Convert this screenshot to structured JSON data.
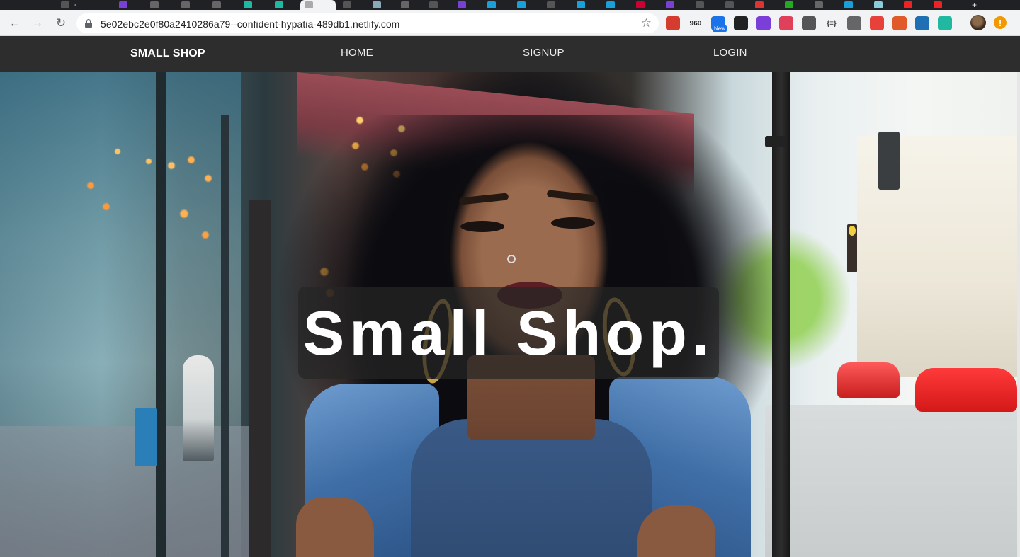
{
  "browser": {
    "url": "5e02ebc2e0f80a2410286a79--confident-hypatia-489db1.netlify.com",
    "extensions": [
      {
        "icon": "red-square-extension-icon",
        "label": "",
        "color": "#d33c2f"
      },
      {
        "icon": "960-extension-icon",
        "label": "960",
        "color": "#222222"
      },
      {
        "icon": "chrome-new-extension-icon",
        "label": "",
        "badge": "New",
        "color": "#1a73e8"
      },
      {
        "icon": "owl-extension-icon",
        "label": "",
        "color": "#222222"
      },
      {
        "icon": "color-cube-extension-icon",
        "label": "",
        "color": "#7b3fd9"
      },
      {
        "icon": "dots-extension-icon",
        "label": "",
        "color": "#e0405a"
      },
      {
        "icon": "eyedropper-extension-icon",
        "label": "",
        "color": "#555555"
      },
      {
        "icon": "json-extension-icon",
        "label": "{≡}",
        "color": "#333333"
      },
      {
        "icon": "gear-extension-icon",
        "label": "",
        "color": "#666666"
      },
      {
        "icon": "swirl-extension-icon",
        "label": "",
        "color": "#e8413b"
      },
      {
        "icon": "mascot-extension-icon",
        "label": "",
        "color": "#e05a2a"
      },
      {
        "icon": "react-extension-icon",
        "label": "",
        "color": "#1e6fb3"
      },
      {
        "icon": "target-extension-icon",
        "label": "",
        "color": "#20b8a0"
      }
    ],
    "update_label": "!"
  },
  "site": {
    "brand": "SMALL SHOP",
    "nav": [
      {
        "label": "HOME"
      },
      {
        "label": "SIGNUP"
      },
      {
        "label": "LOGIN"
      }
    ]
  },
  "hero": {
    "title": "Small Shop."
  },
  "colors": {
    "navbar": "#2d2d2d",
    "overlay": "rgba(38,38,38,0.72)",
    "title_text": "#ffffff"
  }
}
